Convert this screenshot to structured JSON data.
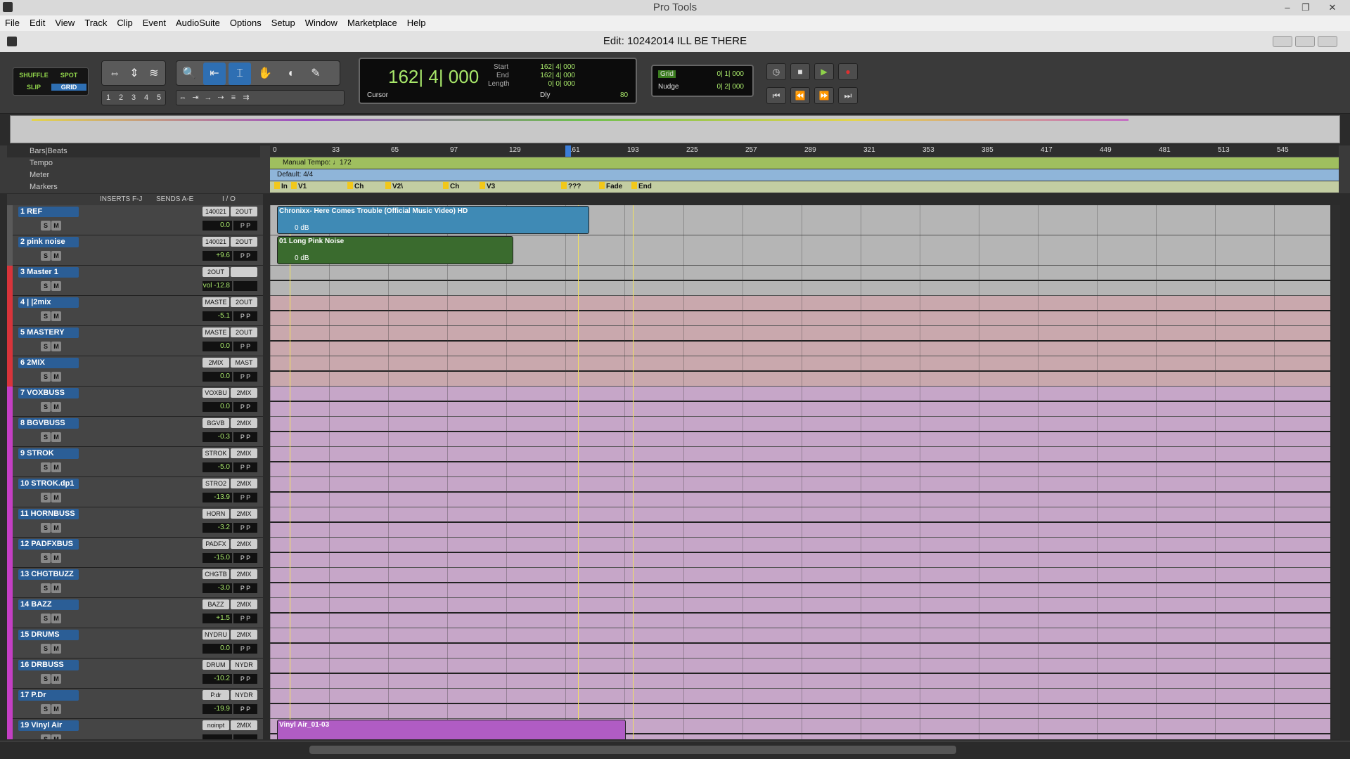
{
  "window": {
    "title": "Pro Tools",
    "min": "–",
    "max": "❐",
    "close": "✕"
  },
  "menu": [
    "File",
    "Edit",
    "View",
    "Track",
    "Clip",
    "Event",
    "AudioSuite",
    "Options",
    "Setup",
    "Window",
    "Marketplace",
    "Help"
  ],
  "edit_window": {
    "title": "Edit: 10242014 ILL BE THERE"
  },
  "modes": {
    "shuffle": "SHUFFLE",
    "spot": "SPOT",
    "slip": "SLIP",
    "grid": "GRID"
  },
  "zoom_presets": [
    "1",
    "2",
    "3",
    "4",
    "5"
  ],
  "counter": {
    "main": "162| 4| 000",
    "start_label": "Start",
    "end_label": "End",
    "length_label": "Length",
    "start": "162| 4| 000",
    "end": "162| 4| 000",
    "length": "0| 0| 000",
    "cursor_label": "Cursor",
    "dly": "Dly",
    "tempo_val": "80"
  },
  "grid": {
    "grid_label": "Grid",
    "grid_value": "0| 1| 000",
    "nudge_label": "Nudge",
    "nudge_value": "0| 2| 000"
  },
  "rulers": {
    "bars_label": "Bars|Beats",
    "tempo_label": "Tempo",
    "meter_label": "Meter",
    "markers_label": "Markers",
    "tempo_text": "Manual Tempo: ♩172",
    "meter_text": "Default: 4/4"
  },
  "bar_ticks": [
    "0",
    "33",
    "65",
    "97",
    "129",
    "161",
    "193",
    "225",
    "257",
    "289",
    "321",
    "353",
    "385",
    "417",
    "449",
    "481",
    "513",
    "545"
  ],
  "markers": [
    "In",
    "V1",
    "Ch",
    "V2\\",
    "Ch",
    "V3",
    "???",
    "Fade",
    "End"
  ],
  "columns": {
    "inserts": "INSERTS F-J",
    "sends": "SENDS A-E",
    "io": "I / O"
  },
  "tracks": [
    {
      "name": "1   REF",
      "io1": "140021",
      "io2": "2OUT",
      "vol": "0.0",
      "pan": "P  P",
      "color": "#5a5a5a"
    },
    {
      "name": "2 pink noise",
      "io1": "140021",
      "io2": "2OUT",
      "vol": "+9.6",
      "pan": "P  P",
      "color": "#5a5a5a"
    },
    {
      "name": "3   Master 1",
      "io1": "2OUT",
      "io2": "",
      "vol": "vol  -12.8",
      "pan": "",
      "color": "#d8343a"
    },
    {
      "name": "4  |  |2mix",
      "io1": "MASTE",
      "io2": "2OUT",
      "vol": "-5.1",
      "pan": "P  P",
      "color": "#d8343a"
    },
    {
      "name": "5   MASTERY",
      "io1": "MASTE",
      "io2": "2OUT",
      "vol": "0.0",
      "pan": "P  P",
      "color": "#d8343a"
    },
    {
      "name": "6     2MIX",
      "io1": "2MIX",
      "io2": "MAST",
      "vol": "0.0",
      "pan": "P  P",
      "color": "#d8343a"
    },
    {
      "name": "7   VOXBUSS",
      "io1": "VOXBU",
      "io2": "2MIX",
      "vol": "0.0",
      "pan": "P  P",
      "color": "#c43fc4"
    },
    {
      "name": "8  BGVBUSS",
      "io1": "BGVB",
      "io2": "2MIX",
      "vol": "-0.3",
      "pan": "P  P",
      "color": "#c43fc4"
    },
    {
      "name": "9     STROK",
      "io1": "STROK",
      "io2": "2MIX",
      "vol": "-5.0",
      "pan": "P  P",
      "color": "#c43fc4"
    },
    {
      "name": "10  STROK.dp1",
      "io1": "STRO2",
      "io2": "2MIX",
      "vol": "-13.9",
      "pan": "P  P",
      "color": "#c43fc4"
    },
    {
      "name": "11  HORNBUSS",
      "io1": "HORN",
      "io2": "2MIX",
      "vol": "-3.2",
      "pan": "P  P",
      "color": "#c43fc4"
    },
    {
      "name": "12  PADFXBUS",
      "io1": "PADFX",
      "io2": "2MIX",
      "vol": "-15.0",
      "pan": "P  P",
      "color": "#c43fc4"
    },
    {
      "name": "13  CHGTBUZZ",
      "io1": "CHGTB",
      "io2": "2MIX",
      "vol": "-3.0",
      "pan": "P  P",
      "color": "#c43fc4"
    },
    {
      "name": "14     BAZZ",
      "io1": "BAZZ",
      "io2": "2MIX",
      "vol": "+1.5",
      "pan": "P  P",
      "color": "#c43fc4"
    },
    {
      "name": "15    DRUMS",
      "io1": "NYDRU",
      "io2": "2MIX",
      "vol": "0.0",
      "pan": "P  P",
      "color": "#c43fc4"
    },
    {
      "name": "16   DRBUSS",
      "io1": "DRUM",
      "io2": "NYDR",
      "vol": "-10.2",
      "pan": "P  P",
      "color": "#c43fc4"
    },
    {
      "name": "17     P.Dr",
      "io1": "P.dr",
      "io2": "NYDR",
      "vol": "-19.9",
      "pan": "P  P",
      "color": "#c43fc4"
    },
    {
      "name": "19  Vinyl Air",
      "io1": "noinpt",
      "io2": "2MIX",
      "vol": "",
      "pan": "",
      "color": "#c43fc4"
    }
  ],
  "clips": [
    {
      "name": "Chronixx- Here Comes Trouble (Official Music Video) HD",
      "gain": "0 dB"
    },
    {
      "name": "01 Long Pink Noise",
      "gain": "0 dB"
    },
    {
      "name": "Vinyl Air_01-03",
      "gain": ""
    }
  ]
}
